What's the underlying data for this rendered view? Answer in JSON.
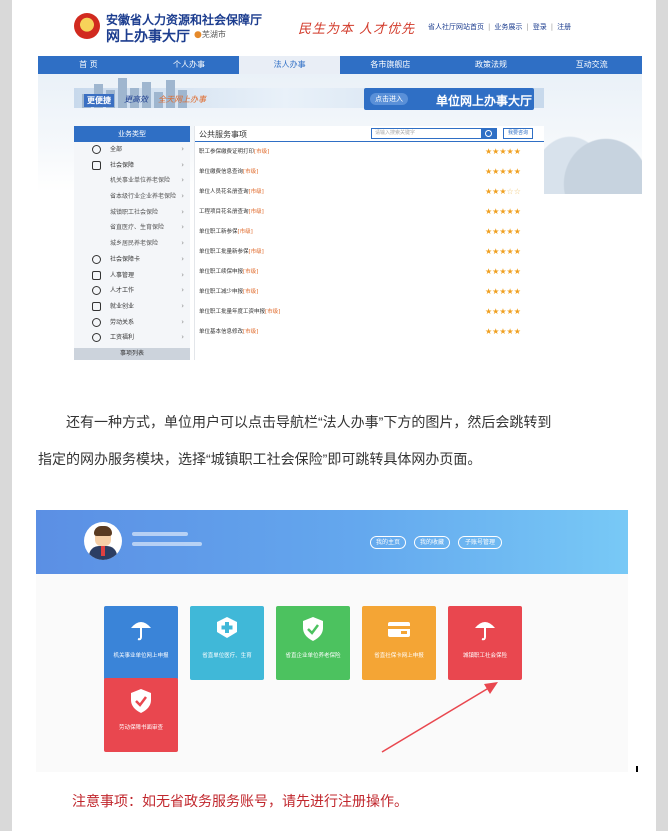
{
  "screenshot1": {
    "header": {
      "org_line1": "安徽省人力资源和社会保障厅",
      "org_line2": "网上办事大厅",
      "city": "芜湖市",
      "slogan": "民生为本  人才优先",
      "links": [
        "省人社厅网站首页",
        "业务展示",
        "登录",
        "注册"
      ]
    },
    "nav": {
      "items": [
        "首 页",
        "个人办事",
        "法人办事",
        "各市旗舰店",
        "政策法规",
        "互动交流"
      ],
      "active_index": 2
    },
    "banner": {
      "left_tag": "更便捷",
      "left_tag2": "更高效",
      "left_text": "全天网上办事",
      "right_pill": "点击进入",
      "right_title": "单位网上办事大厅"
    },
    "sidebar": {
      "title": "业务类型",
      "items": [
        {
          "label": "全部",
          "icon": "grid-icon",
          "level": "top"
        },
        {
          "label": "社会保障",
          "icon": "shield-icon",
          "level": "top"
        },
        {
          "label": "机关事业单位养老保险",
          "level": "sub"
        },
        {
          "label": "省本级行业企业养老保险",
          "level": "sub"
        },
        {
          "label": "城镇职工社会保险",
          "level": "sub"
        },
        {
          "label": "省直医疗、生育保险",
          "level": "sub"
        },
        {
          "label": "城乡居民养老保险",
          "level": "sub"
        },
        {
          "label": "社会保障卡",
          "icon": "card-icon",
          "level": "top"
        },
        {
          "label": "人事管理",
          "icon": "people-icon",
          "level": "top"
        },
        {
          "label": "人才工作",
          "icon": "cap-icon",
          "level": "top"
        },
        {
          "label": "就业创业",
          "icon": "briefcase-icon",
          "level": "top"
        },
        {
          "label": "劳动关系",
          "icon": "handshake-icon",
          "level": "top"
        },
        {
          "label": "工资福利",
          "icon": "coin-icon",
          "level": "top"
        }
      ],
      "more": "事项列表"
    },
    "list": {
      "title": "公共服务事项",
      "search_placeholder": "请输入搜索关键字",
      "ask_button": "我要咨询",
      "rows": [
        {
          "text": "职工参保缴费证明打印",
          "tag": "[市级]",
          "stars": 5
        },
        {
          "text": "单位缴费信息查询",
          "tag": "[市级]",
          "stars": 5
        },
        {
          "text": "单位人员花名册查询",
          "tag": "[市级]",
          "stars": 3
        },
        {
          "text": "工程项目花名册查询",
          "tag": "[市级]",
          "stars": 5
        },
        {
          "text": "单位职工新参保",
          "tag": "[市级]",
          "stars": 5
        },
        {
          "text": "单位职工批量新参保",
          "tag": "[市级]",
          "stars": 5
        },
        {
          "text": "单位职工续保申报",
          "tag": "[市级]",
          "stars": 5
        },
        {
          "text": "单位职工减少申报",
          "tag": "[市级]",
          "stars": 5
        },
        {
          "text": "单位职工批量年度工资申报",
          "tag": "[市级]",
          "stars": 5
        },
        {
          "text": "单位基本信息修改",
          "tag": "[市级]",
          "stars": 5
        }
      ]
    }
  },
  "paragraph": {
    "line1": "还有一种方式，单位用户可以点击导航栏“法人办事”下方的图片，然后会跳转到",
    "line2": "指定的网办服务模块，选择“城镇职工社会保险”即可跳转具体网办页面。"
  },
  "screenshot2": {
    "buttons": [
      "我的主页",
      "我的收藏",
      "子账号管理"
    ],
    "tiles": [
      {
        "label": "机关事业单位网上申报",
        "color": "#3a84d8",
        "icon": "umbrella-icon"
      },
      {
        "label": "省直单位医疗、生育",
        "color": "#40b8d8",
        "icon": "medical-cross-icon"
      },
      {
        "label": "省直企业单位养老保险",
        "color": "#4cc25f",
        "icon": "shield-check-icon"
      },
      {
        "label": "省直社保卡网上申报",
        "color": "#f4a535",
        "icon": "card-icon"
      },
      {
        "label": "城镇职工社会保险",
        "color": "#e9474f",
        "icon": "umbrella-icon"
      },
      {
        "label": "劳动保障书面审查",
        "color": "#e9474f",
        "icon": "shield-check-icon"
      }
    ],
    "highlight_index": 4,
    "pointer_color": "#e9474f"
  },
  "notice": "注意事项：如无省政务服务账号，请先进行注册操作。"
}
